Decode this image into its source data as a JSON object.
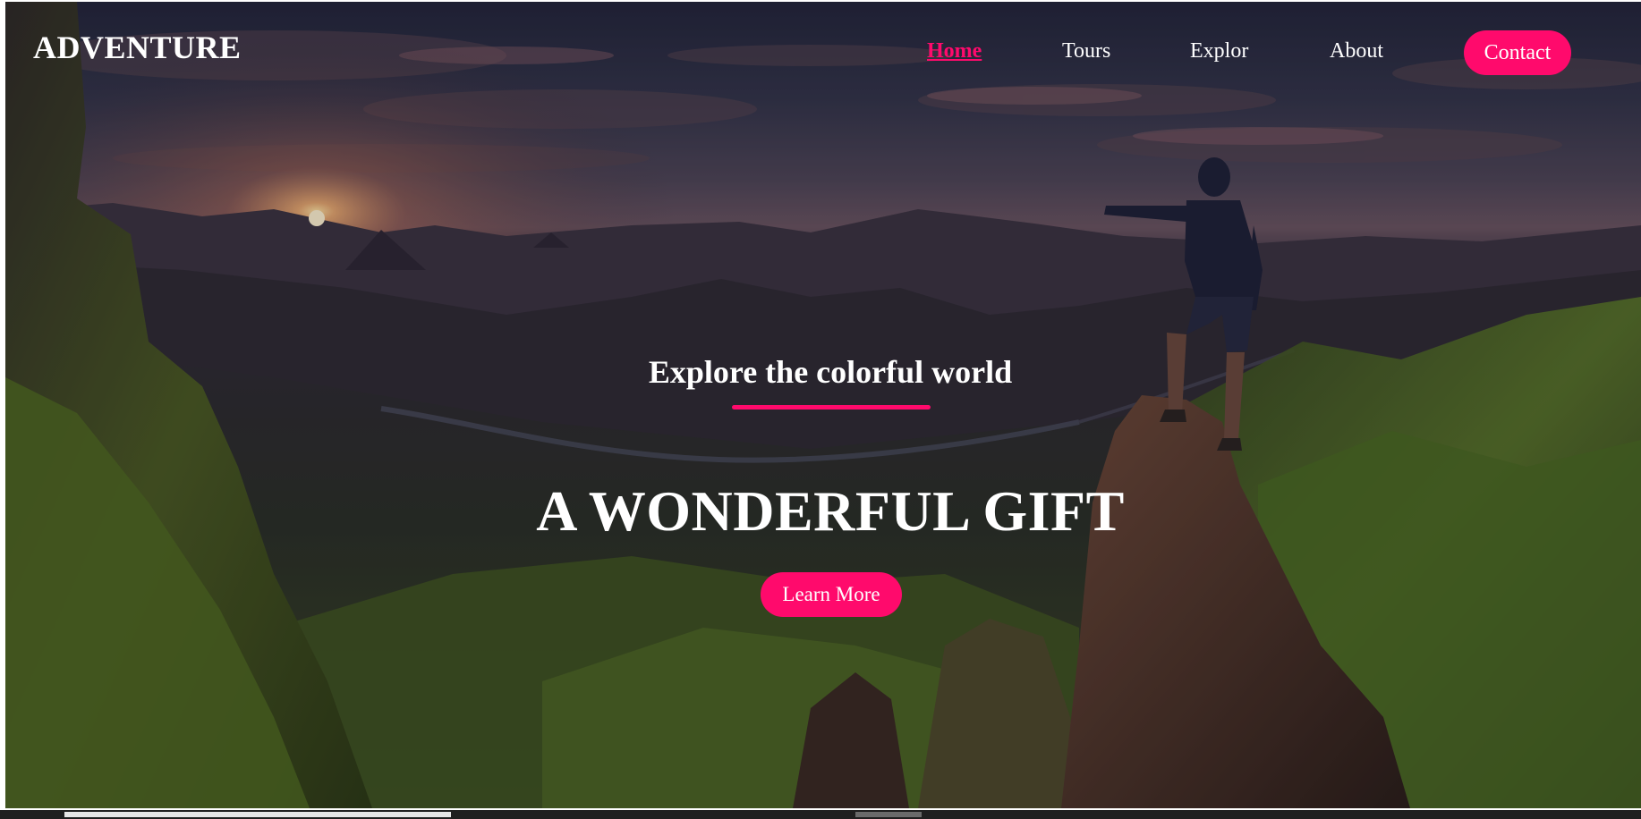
{
  "header": {
    "logo": "ADVENTURE",
    "nav": [
      {
        "label": "Home",
        "active": true
      },
      {
        "label": "Tours",
        "active": false
      },
      {
        "label": "Explor",
        "active": false
      },
      {
        "label": "About",
        "active": false
      }
    ],
    "contact_label": "Contact"
  },
  "hero": {
    "tagline": "Explore the colorful world",
    "headline": "A WONDERFUL GIFT",
    "cta_label": "Learn More",
    "background": "mountain-sunset-hiker-image"
  },
  "colors": {
    "accent": "#ff0a6c",
    "text": "#ffffff"
  }
}
